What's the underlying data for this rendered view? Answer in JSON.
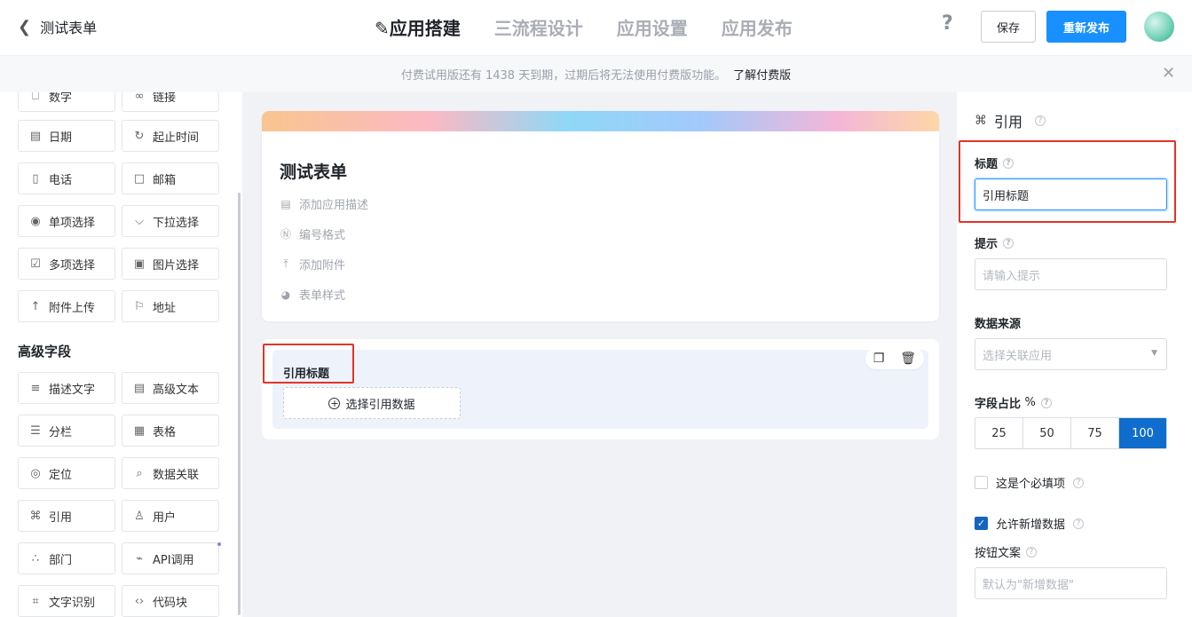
{
  "header": {
    "back_label": "测试表单",
    "steps": [
      "应用搭建",
      "三流程设计",
      "应用设置",
      "应用发布"
    ],
    "help": "?",
    "save_label": "保存",
    "publish_label": "重新发布"
  },
  "notice": {
    "text": "付费试用版还有 1438 天到期，过期后将无法使用付费版功能。",
    "link": "了解付费版",
    "close": "✕"
  },
  "left_panel": {
    "basic_fields": [
      {
        "label": "数字",
        "icon": "number-icon"
      },
      {
        "label": "链接",
        "icon": "link-icon"
      },
      {
        "label": "日期",
        "icon": "calendar-icon"
      },
      {
        "label": "起止时间",
        "icon": "time-range-icon"
      },
      {
        "label": "电话",
        "icon": "phone-icon"
      },
      {
        "label": "邮箱",
        "icon": "mail-icon"
      },
      {
        "label": "单项选择",
        "icon": "radio-icon"
      },
      {
        "label": "下拉选择",
        "icon": "dropdown-icon"
      },
      {
        "label": "多项选择",
        "icon": "checkbox-icon"
      },
      {
        "label": "图片选择",
        "icon": "image-icon"
      },
      {
        "label": "附件上传",
        "icon": "upload-icon"
      },
      {
        "label": "地址",
        "icon": "location-icon"
      }
    ],
    "advanced_title": "高级字段",
    "advanced_fields": [
      {
        "label": "描述文字",
        "icon": "text-icon"
      },
      {
        "label": "高级文本",
        "icon": "richtext-icon"
      },
      {
        "label": "分栏",
        "icon": "columns-icon"
      },
      {
        "label": "表格",
        "icon": "table-icon"
      },
      {
        "label": "定位",
        "icon": "pin-icon"
      },
      {
        "label": "数据关联",
        "icon": "data-link-icon"
      },
      {
        "label": "引用",
        "icon": "reference-icon"
      },
      {
        "label": "用户",
        "icon": "user-icon"
      },
      {
        "label": "部门",
        "icon": "department-icon"
      },
      {
        "label": "API调用",
        "icon": "api-icon"
      },
      {
        "label": "文字识别",
        "icon": "ocr-icon"
      },
      {
        "label": "代码块",
        "icon": "code-icon"
      }
    ]
  },
  "form": {
    "title": "测试表单",
    "options": [
      "添加应用描述",
      "编号格式",
      "添加附件",
      "表单样式"
    ],
    "field_label": "引用标题",
    "pick_label": "选择引用数据"
  },
  "props": {
    "heading": "引用",
    "title_label": "标题",
    "title_value": "引用标题",
    "hint_label": "提示",
    "hint_placeholder": "请输入提示",
    "source_label": "数据来源",
    "source_placeholder": "选择关联应用",
    "ratio_label": "字段占比",
    "ratio_unit": "%",
    "ratio_options": [
      "25",
      "50",
      "75",
      "100"
    ],
    "ratio_selected": "100",
    "required_label": "这是个必填项",
    "required_checked": false,
    "allow_add_label": "允许新增数据",
    "allow_add_checked": true,
    "button_text_label": "按钮文案",
    "button_text_placeholder": "默认为\"新增数据\""
  },
  "colors": {
    "accent": "#1890ff",
    "selected_ratio": "#0f6ecd",
    "highlight_box": "#e3332a"
  }
}
